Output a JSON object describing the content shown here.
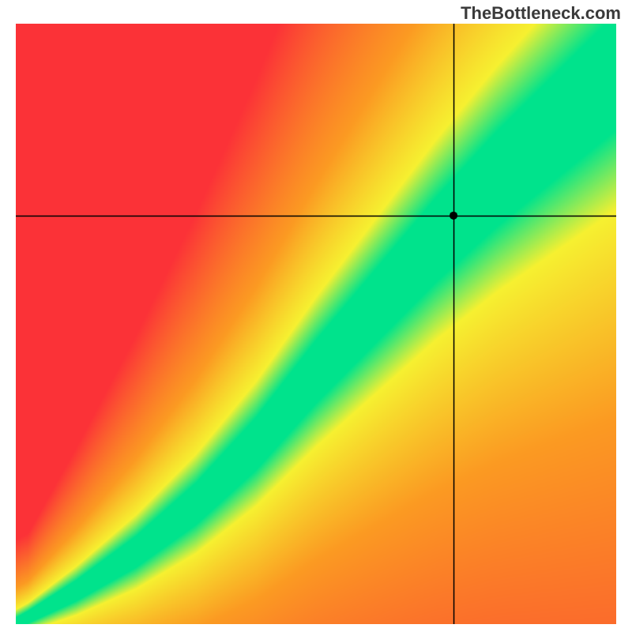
{
  "watermark": "TheBottleneck.com",
  "chart_data": {
    "type": "heatmap",
    "title": "",
    "xlabel": "",
    "ylabel": "",
    "xlim": [
      0,
      1
    ],
    "ylim": [
      0,
      1
    ],
    "crosshair": {
      "x": 0.73,
      "y": 0.68
    },
    "optimal_curve_anchors": [
      {
        "x": 0.0,
        "y": 0.0
      },
      {
        "x": 0.1,
        "y": 0.055
      },
      {
        "x": 0.2,
        "y": 0.12
      },
      {
        "x": 0.3,
        "y": 0.2
      },
      {
        "x": 0.4,
        "y": 0.3
      },
      {
        "x": 0.5,
        "y": 0.42
      },
      {
        "x": 0.6,
        "y": 0.53
      },
      {
        "x": 0.7,
        "y": 0.64
      },
      {
        "x": 0.8,
        "y": 0.74
      },
      {
        "x": 0.9,
        "y": 0.83
      },
      {
        "x": 1.0,
        "y": 0.92
      }
    ],
    "band_width_normalized": 0.055,
    "colors": {
      "optimal": "#00E38C",
      "near": "#F6F030",
      "warm": "#FB9A22",
      "bad": "#FB3237"
    },
    "note": "Heatmap color encodes distance from the optimal CPU/GPU balance curve. Green = balanced, yellow = mild bottleneck, orange/red = severe bottleneck. Black crosshair and dot mark the queried configuration."
  }
}
